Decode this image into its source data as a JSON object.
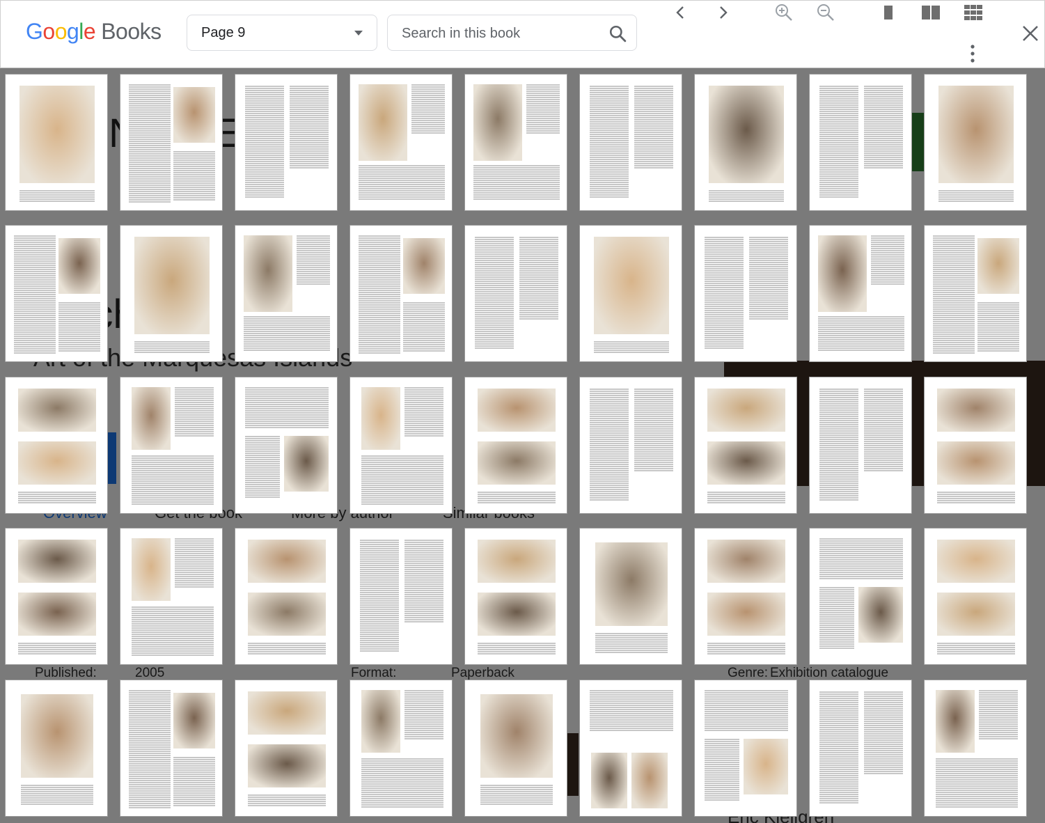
{
  "app": {
    "logo_google": [
      "G",
      "o",
      "o",
      "g",
      "l",
      "e"
    ],
    "logo_books": "Books"
  },
  "toolbar": {
    "page_selector_value": "Page 9",
    "search_placeholder": "Search in this book",
    "icons": [
      "chevron-left-icon",
      "chevron-right-icon",
      "zoom-in-icon",
      "zoom-out-icon",
      "single-page-icon",
      "two-page-icon",
      "grid-view-icon",
      "close-icon",
      "more-vert-icon"
    ]
  },
  "background_page": {
    "metadata": {
      "published_label": "Published:",
      "published_value": "2005",
      "format_label": "Format:",
      "format_value": "Paperback",
      "genre_label": "Genre:",
      "genre_value": "Exhibition catalogue"
    },
    "tabs": [
      "Overview",
      "Get the book",
      "More by author",
      "Similar books"
    ],
    "author": "Eric Kjellgren"
  },
  "thumbnails": {
    "rows": 5,
    "columns": 9,
    "layouts": [
      "illus",
      "text-illus",
      "text",
      "illus-text",
      "illus-text",
      "text",
      "illus",
      "text",
      "illus",
      "text-illus",
      "illus",
      "illus-text",
      "text-illus",
      "text",
      "illus",
      "text",
      "illus-text",
      "text-illus",
      "photo2",
      "photo-text",
      "text-photo",
      "photo-text",
      "photo2",
      "text",
      "photo2",
      "text",
      "photo2",
      "photo2",
      "photo-text",
      "photo2",
      "text",
      "photo2",
      "photo",
      "photo2",
      "text-photo",
      "photo2",
      "photo",
      "text-illus",
      "photo2",
      "photo-text",
      "photo",
      "text-photo2",
      "text-photo",
      "text",
      "photo-text"
    ]
  }
}
